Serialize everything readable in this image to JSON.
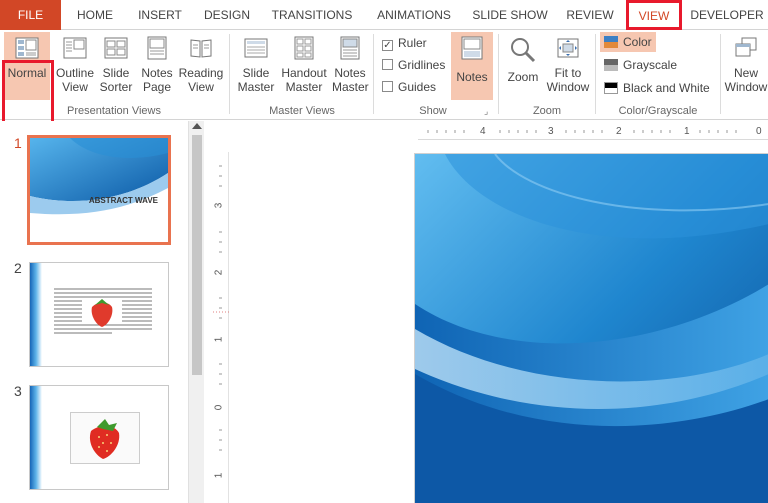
{
  "tabs": [
    {
      "label": "FILE"
    },
    {
      "label": "HOME"
    },
    {
      "label": "INSERT"
    },
    {
      "label": "DESIGN"
    },
    {
      "label": "TRANSITIONS"
    },
    {
      "label": "ANIMATIONS"
    },
    {
      "label": "SLIDE SHOW"
    },
    {
      "label": "REVIEW"
    },
    {
      "label": "VIEW"
    },
    {
      "label": "DEVELOPER"
    }
  ],
  "ribbon": {
    "presentation_views": {
      "label": "Presentation Views",
      "normal": "Normal",
      "outline_view": [
        "Outline",
        "View"
      ],
      "slide_sorter": [
        "Slide",
        "Sorter"
      ],
      "notes_page": [
        "Notes",
        "Page"
      ],
      "reading_view": [
        "Reading",
        "View"
      ]
    },
    "master_views": {
      "label": "Master Views",
      "slide_master": [
        "Slide",
        "Master"
      ],
      "handout_master": [
        "Handout",
        "Master"
      ],
      "notes_master": [
        "Notes",
        "Master"
      ]
    },
    "show": {
      "label": "Show",
      "ruler": "Ruler",
      "gridlines": "Gridlines",
      "guides": "Guides",
      "notes": "Notes",
      "ruler_checked": true
    },
    "zoom": {
      "label": "Zoom",
      "zoom": "Zoom",
      "fit_to_window": [
        "Fit to",
        "Window"
      ]
    },
    "color_grayscale": {
      "label": "Color/Grayscale",
      "color": "Color",
      "grayscale": "Grayscale",
      "black_and_white": "Black and White"
    },
    "window": {
      "new_window": [
        "New",
        "Window"
      ]
    }
  },
  "slides": [
    {
      "number": "1",
      "title": "ABSTRACT WAVE"
    },
    {
      "number": "2"
    },
    {
      "number": "3"
    }
  ],
  "ruler": {
    "horizontal": [
      "4",
      "3",
      "2",
      "1",
      "0"
    ],
    "vertical": [
      "3",
      "2",
      "1",
      "0",
      "1"
    ]
  },
  "colors": {
    "accent": "#d24726",
    "highlight": "#f6c7b1",
    "slide_blue": "#1e7fc8",
    "callout_red": "#e8192c"
  }
}
